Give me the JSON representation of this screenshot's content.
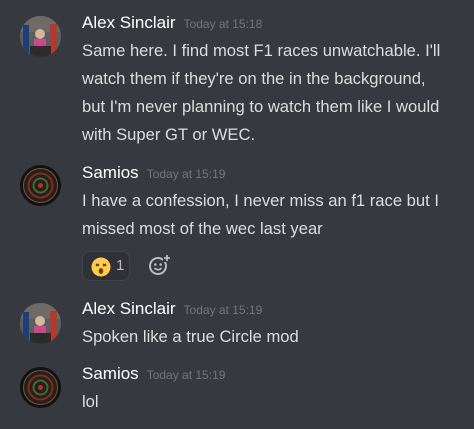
{
  "messages": [
    {
      "author": "Alex Sinclair",
      "timestamp": "Today at 15:18",
      "lines": [
        "Same here. I find most F1 races unwatchable. I'll",
        "watch them if they're on the in the background,",
        "but I'm never planning to watch them like I would",
        "with Super GT or WEC."
      ]
    },
    {
      "author": "Samios",
      "timestamp": "Today at 15:19",
      "lines": [
        "I have a confession, I never miss an f1 race but I",
        "missed most of the wec last year"
      ],
      "reaction": {
        "emoji": "astonished-face-emoji",
        "count": "1"
      }
    },
    {
      "author": "Alex Sinclair",
      "timestamp": "Today at 15:19",
      "lines": [
        "Spoken like a true Circle mod"
      ]
    },
    {
      "author": "Samios",
      "timestamp": "Today at 15:19",
      "lines": [
        "lol"
      ]
    }
  ],
  "colors": {
    "background": "#36393f",
    "username": "#ffffff",
    "timestamp": "#72767d",
    "text": "#dcddde"
  }
}
